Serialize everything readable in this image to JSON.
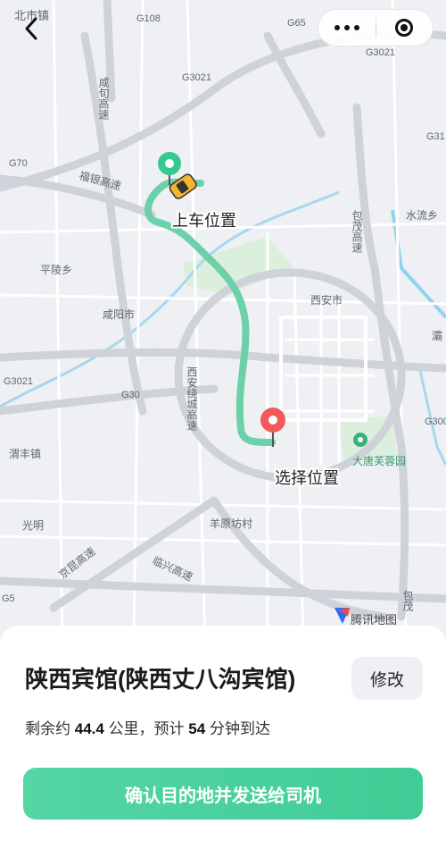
{
  "map": {
    "labels": {
      "beishi": "北市镇",
      "g108": "G108",
      "g65": "G65",
      "g3021_top": "G3021",
      "g3021_mid": "G3021",
      "g31": "G31",
      "g70": "G70",
      "xianyang_hw": "咸旬高速",
      "fuyin_hw": "福银高速",
      "baomao_hw": "包茂高速",
      "shuiliu": "水流乡",
      "pingling": "平陵乡",
      "xianyang_city": "咸阳市",
      "xian_city": "西安市",
      "g3021_left": "G3021",
      "g30": "G30",
      "xian_ring": "西安绕城高速",
      "ba": "灞",
      "g300": "G300",
      "weifeng": "渭丰镇",
      "datang": "大唐芙蓉园",
      "guangming": "光明",
      "yangyuan": "羊原坊村",
      "jingkun_hw": "京昆高速",
      "linxing_hw": "临兴高速",
      "baomao_bottom": "包茂",
      "g5": "G5",
      "tencent_map": "腾讯地图"
    },
    "pickup_label": "上车位置",
    "dest_label": "选择位置",
    "route_color": "#6cd0a8",
    "pickup_pin_color": "#35c98e",
    "dest_pin_color": "#f05a5a",
    "car_color": "#f6b52d"
  },
  "nav": {
    "back_icon": "chevron-left-icon",
    "more_icon": "more-dots-icon",
    "close_icon": "target-close-icon"
  },
  "sheet": {
    "destination": "陕西宾馆(陕西丈八沟宾馆)",
    "edit_label": "修改",
    "summary": {
      "prefix": "剩余约",
      "distance": "44.4",
      "distance_unit": "公里，预计",
      "eta": "54",
      "eta_unit": "分钟到达"
    },
    "confirm_label": "确认目的地并发送给司机"
  },
  "colors": {
    "accent": "#45cf99"
  }
}
